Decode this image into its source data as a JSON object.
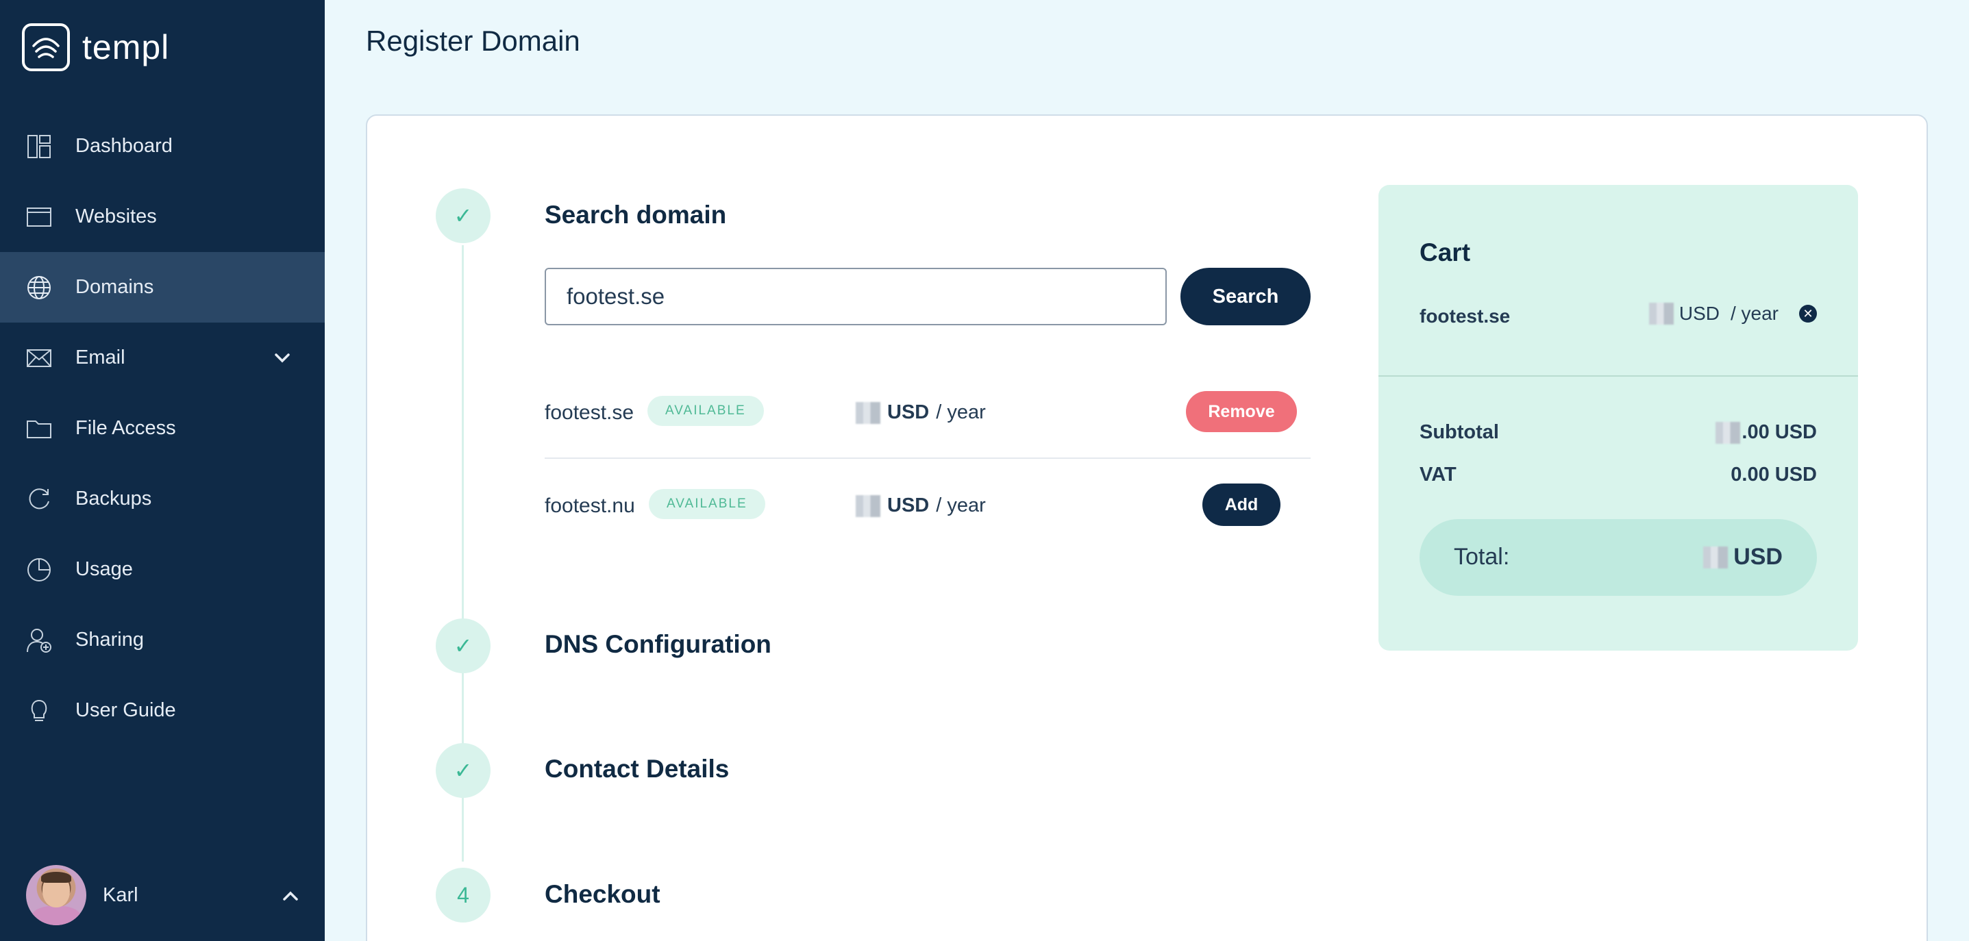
{
  "app": {
    "name": "templ"
  },
  "sidebar": {
    "items": [
      {
        "label": "Dashboard",
        "icon": "dashboard-icon"
      },
      {
        "label": "Websites",
        "icon": "browser-icon"
      },
      {
        "label": "Domains",
        "icon": "globe-icon",
        "active": true
      },
      {
        "label": "Email",
        "icon": "envelope-icon",
        "expandable": true
      },
      {
        "label": "File Access",
        "icon": "folder-icon"
      },
      {
        "label": "Backups",
        "icon": "refresh-icon"
      },
      {
        "label": "Usage",
        "icon": "pie-chart-icon"
      },
      {
        "label": "Sharing",
        "icon": "user-share-icon"
      },
      {
        "label": "User Guide",
        "icon": "lightbulb-icon"
      }
    ],
    "user": {
      "name": "Karl"
    }
  },
  "page": {
    "title": "Register Domain"
  },
  "steps": [
    {
      "marker": "✓",
      "title": "Search domain",
      "done": true
    },
    {
      "marker": "✓",
      "title": "DNS Configuration",
      "done": true
    },
    {
      "marker": "✓",
      "title": "Contact Details",
      "done": true
    },
    {
      "marker": "4",
      "title": "Checkout",
      "done": false
    }
  ],
  "search": {
    "value": "footest.se",
    "button_label": "Search"
  },
  "results": [
    {
      "domain": "footest.se",
      "status": "AVAILABLE",
      "currency": "USD",
      "period": "/ year",
      "action": "Remove"
    },
    {
      "domain": "footest.nu",
      "status": "AVAILABLE",
      "currency": "USD",
      "period": "/ year",
      "action": "Add"
    }
  ],
  "cart": {
    "title": "Cart",
    "item": {
      "domain": "footest.se",
      "currency": "USD",
      "period": "/ year"
    },
    "subtotal": {
      "label": "Subtotal",
      "value": ".00 USD"
    },
    "vat": {
      "label": "VAT",
      "value": "0.00 USD"
    },
    "total": {
      "label": "Total:",
      "value": "USD"
    }
  },
  "colors": {
    "sidebar_bg": "#0f2a47",
    "accent": "#3bb895",
    "danger": "#f0707a",
    "cart_bg": "#d9f4ec"
  }
}
